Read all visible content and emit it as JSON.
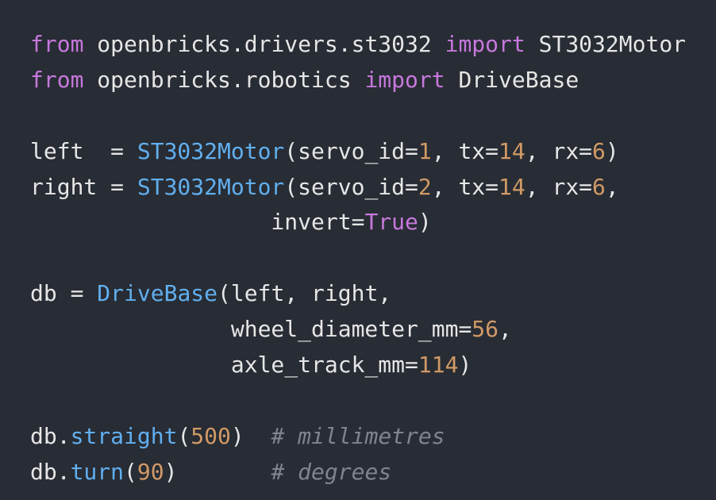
{
  "colors": {
    "background": "#282c34",
    "text": "#e6e6e6",
    "keyword": "#c678dd",
    "function": "#61afef",
    "number": "#d19a66",
    "comment": "#7f848e"
  },
  "code": {
    "lines": [
      [
        {
          "t": "kw",
          "v": "from"
        },
        {
          "t": "plain",
          "v": " openbricks.drivers.st3032 "
        },
        {
          "t": "kw",
          "v": "import"
        },
        {
          "t": "plain",
          "v": " ST3032Motor"
        }
      ],
      [
        {
          "t": "kw",
          "v": "from"
        },
        {
          "t": "plain",
          "v": " openbricks.robotics "
        },
        {
          "t": "kw",
          "v": "import"
        },
        {
          "t": "plain",
          "v": " DriveBase"
        }
      ],
      [],
      [
        {
          "t": "plain",
          "v": "left  = "
        },
        {
          "t": "fn",
          "v": "ST3032Motor"
        },
        {
          "t": "plain",
          "v": "(servo_id="
        },
        {
          "t": "num",
          "v": "1"
        },
        {
          "t": "plain",
          "v": ", tx="
        },
        {
          "t": "num",
          "v": "14"
        },
        {
          "t": "plain",
          "v": ", rx="
        },
        {
          "t": "num",
          "v": "6"
        },
        {
          "t": "plain",
          "v": ")"
        }
      ],
      [
        {
          "t": "plain",
          "v": "right = "
        },
        {
          "t": "fn",
          "v": "ST3032Motor"
        },
        {
          "t": "plain",
          "v": "(servo_id="
        },
        {
          "t": "num",
          "v": "2"
        },
        {
          "t": "plain",
          "v": ", tx="
        },
        {
          "t": "num",
          "v": "14"
        },
        {
          "t": "plain",
          "v": ", rx="
        },
        {
          "t": "num",
          "v": "6"
        },
        {
          "t": "plain",
          "v": ","
        }
      ],
      [
        {
          "t": "plain",
          "v": "                  invert="
        },
        {
          "t": "kw",
          "v": "True"
        },
        {
          "t": "plain",
          "v": ")"
        }
      ],
      [],
      [
        {
          "t": "plain",
          "v": "db = "
        },
        {
          "t": "fn",
          "v": "DriveBase"
        },
        {
          "t": "plain",
          "v": "(left, right,"
        }
      ],
      [
        {
          "t": "plain",
          "v": "               wheel_diameter_mm="
        },
        {
          "t": "num",
          "v": "56"
        },
        {
          "t": "plain",
          "v": ","
        }
      ],
      [
        {
          "t": "plain",
          "v": "               axle_track_mm="
        },
        {
          "t": "num",
          "v": "114"
        },
        {
          "t": "plain",
          "v": ")"
        }
      ],
      [],
      [
        {
          "t": "plain",
          "v": "db."
        },
        {
          "t": "fn",
          "v": "straight"
        },
        {
          "t": "plain",
          "v": "("
        },
        {
          "t": "num",
          "v": "500"
        },
        {
          "t": "plain",
          "v": ")  "
        },
        {
          "t": "cmt",
          "v": "# millimetres"
        }
      ],
      [
        {
          "t": "plain",
          "v": "db."
        },
        {
          "t": "fn",
          "v": "turn"
        },
        {
          "t": "plain",
          "v": "("
        },
        {
          "t": "num",
          "v": "90"
        },
        {
          "t": "plain",
          "v": ")       "
        },
        {
          "t": "cmt",
          "v": "# degrees"
        }
      ]
    ]
  }
}
